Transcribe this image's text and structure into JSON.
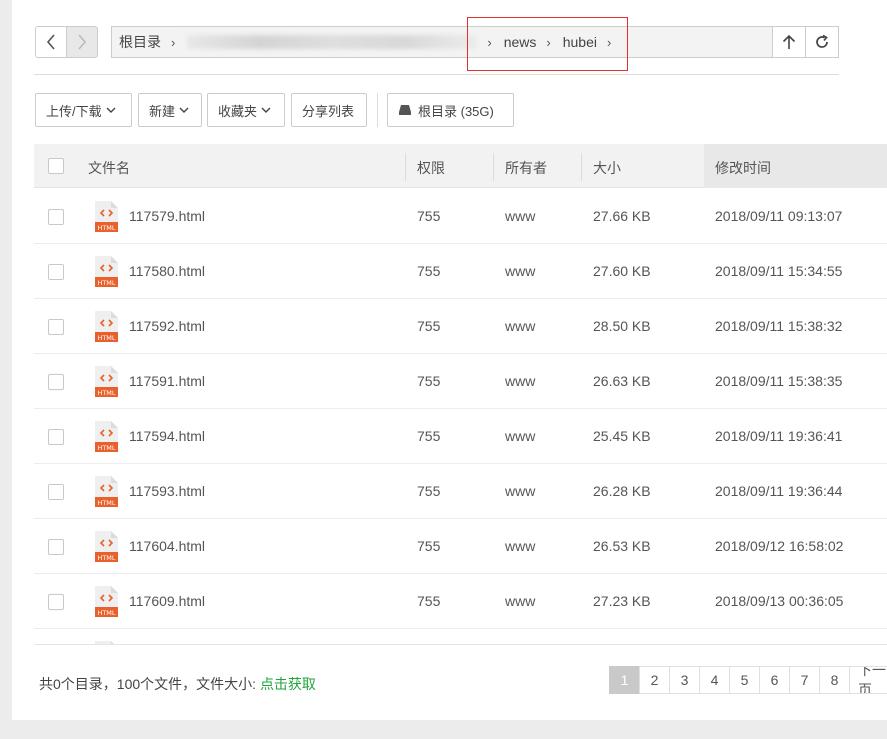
{
  "nav": {
    "breadcrumbs": [
      {
        "label": "根目录",
        "blurred": false
      },
      {
        "label": "news",
        "blurred": false
      },
      {
        "label": "hubei",
        "blurred": false
      }
    ]
  },
  "toolbar": {
    "upload_download": "上传/下载",
    "new": "新建",
    "favorites": "收藏夹",
    "share_list": "分享列表",
    "disk": "根目录 (35G)"
  },
  "table": {
    "columns": {
      "name": "文件名",
      "perm": "权限",
      "owner": "所有者",
      "size": "大小",
      "mtime": "修改时间"
    },
    "rows": [
      {
        "name": "117579.html",
        "perm": "755",
        "owner": "www",
        "size": "27.66 KB",
        "mtime": "2018/09/11 09:13:07"
      },
      {
        "name": "117580.html",
        "perm": "755",
        "owner": "www",
        "size": "27.60 KB",
        "mtime": "2018/09/11 15:34:55"
      },
      {
        "name": "117592.html",
        "perm": "755",
        "owner": "www",
        "size": "28.50 KB",
        "mtime": "2018/09/11 15:38:32"
      },
      {
        "name": "117591.html",
        "perm": "755",
        "owner": "www",
        "size": "26.63 KB",
        "mtime": "2018/09/11 15:38:35"
      },
      {
        "name": "117594.html",
        "perm": "755",
        "owner": "www",
        "size": "25.45 KB",
        "mtime": "2018/09/11 19:36:41"
      },
      {
        "name": "117593.html",
        "perm": "755",
        "owner": "www",
        "size": "26.28 KB",
        "mtime": "2018/09/11 19:36:44"
      },
      {
        "name": "117604.html",
        "perm": "755",
        "owner": "www",
        "size": "26.53 KB",
        "mtime": "2018/09/12 16:58:02"
      },
      {
        "name": "117609.html",
        "perm": "755",
        "owner": "www",
        "size": "27.23 KB",
        "mtime": "2018/09/13 00:36:05"
      },
      {
        "name": "",
        "perm": "",
        "owner": "",
        "size": "",
        "mtime": ""
      }
    ],
    "icon_label": "HTML"
  },
  "footer": {
    "summary": "共0个目录，100个文件，文件大小:",
    "fetch_link": "点击获取",
    "pages": [
      "1",
      "2",
      "3",
      "4",
      "5",
      "6",
      "7",
      "8"
    ],
    "current_page": "1",
    "next_label": "下一页"
  },
  "colors": {
    "accent_green": "#20a53a",
    "highlight_red": "#e03030",
    "html_icon_orange": "#e8612c"
  }
}
